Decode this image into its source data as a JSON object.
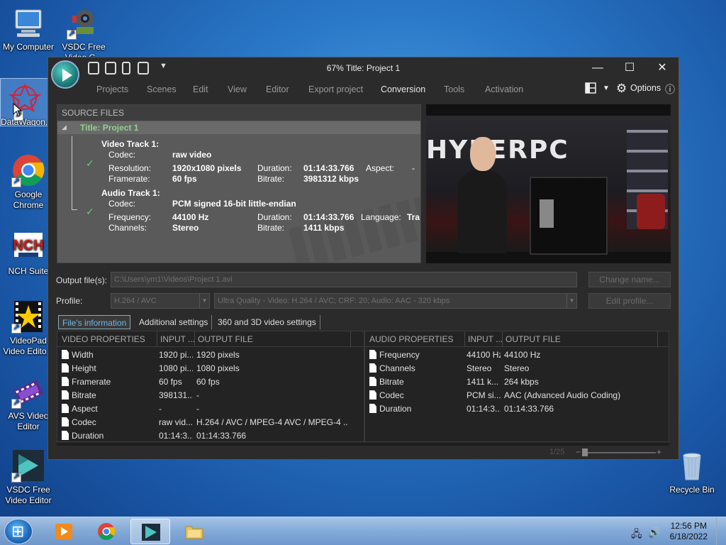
{
  "desktop": {
    "icons": [
      {
        "label": "My Computer"
      },
      {
        "label": "VSDC Free Video C..."
      },
      {
        "label": "DataWagon..."
      },
      {
        "label": "Google Chrome"
      },
      {
        "label": "NCH Suite"
      },
      {
        "label": "VideoPad Video Edito..."
      },
      {
        "label": "AVS Video Editor"
      },
      {
        "label": "VSDC Free Video Editor"
      },
      {
        "label": "Recycle Bin"
      }
    ]
  },
  "window": {
    "title": "67% Title: Project 1",
    "menu": [
      "Projects",
      "Scenes",
      "Edit",
      "View",
      "Editor",
      "Export project",
      "Conversion",
      "Tools",
      "Activation"
    ],
    "active_menu": "Conversion",
    "options_label": "Options",
    "info_icon": "ⓘ",
    "min_icon": "—",
    "max_icon": "☐",
    "close_icon": "✕"
  },
  "source_files": {
    "header": "SOURCE FILES",
    "project_title": "Title: Project 1",
    "video_track": {
      "name": "Video Track 1:",
      "codec_label": "Codec:",
      "codec": "raw video",
      "resolution_label": "Resolution:",
      "resolution": "1920x1080 pixels",
      "duration_label": "Duration:",
      "duration": "01:14:33.766",
      "aspect_label": "Aspect:",
      "aspect": "-",
      "framerate_label": "Framerate:",
      "framerate": "60 fps",
      "bitrate_label": "Bitrate:",
      "bitrate": "3981312 kbps"
    },
    "audio_track": {
      "name": "Audio Track 1:",
      "codec_label": "Codec:",
      "codec": "PCM signed 16-bit little-endian",
      "frequency_label": "Frequency:",
      "frequency": "44100 Hz",
      "duration_label": "Duration:",
      "duration": "01:14:33.766",
      "language_label": "Language:",
      "language": "Tra",
      "channels_label": "Channels:",
      "channels": "Stereo",
      "bitrate_label": "Bitrate:",
      "bitrate": "1411 kbps"
    }
  },
  "preview": {
    "overlay_text": "HYPERPC"
  },
  "output": {
    "label": "Output file(s):",
    "path": "C:\\Users\\ym1\\Videos\\Project 1.avi",
    "change_name": "Change name...",
    "profile_label": "Profile:",
    "profile_format": "H.264 / AVC",
    "profile_preset": "Ultra Quality - Video: H.264 / AVC; CRF: 20; Audio: AAC - 320 kbps",
    "edit_profile": "Edit profile..."
  },
  "tabs": [
    "File's information",
    "Additional settings",
    "360 and 3D video settings"
  ],
  "video_table": {
    "headers": [
      "VIDEO PROPERTIES",
      "INPUT ...",
      "OUTPUT FILE"
    ],
    "rows": [
      [
        "Width",
        "1920 pi...",
        "1920 pixels"
      ],
      [
        "Height",
        "1080 pi...",
        "1080 pixels"
      ],
      [
        "Framerate",
        "60 fps",
        "60 fps"
      ],
      [
        "Bitrate",
        "398131...",
        "-"
      ],
      [
        "Aspect",
        "-",
        "-"
      ],
      [
        "Codec",
        "raw vid...",
        "H.264 / AVC / MPEG-4 AVC / MPEG-4 ..."
      ],
      [
        "Duration",
        "01:14:3...",
        "01:14:33.766"
      ]
    ]
  },
  "audio_table": {
    "headers": [
      "AUDIO PROPERTIES",
      "INPUT ...",
      "OUTPUT FILE"
    ],
    "rows": [
      [
        "Frequency",
        "44100 Hz",
        "44100 Hz"
      ],
      [
        "Channels",
        "Stereo",
        "Stereo"
      ],
      [
        "Bitrate",
        "1411 k...",
        "264 kbps"
      ],
      [
        "Codec",
        "PCM si...",
        "AAC (Advanced Audio Coding)"
      ],
      [
        "Duration",
        "01:14:3...",
        "01:14:33.766"
      ]
    ]
  },
  "zoom": {
    "label": "1/25",
    "minus": "−",
    "plus": "+"
  },
  "taskbar": {
    "time": "12:56 PM",
    "date": "6/18/2022"
  }
}
